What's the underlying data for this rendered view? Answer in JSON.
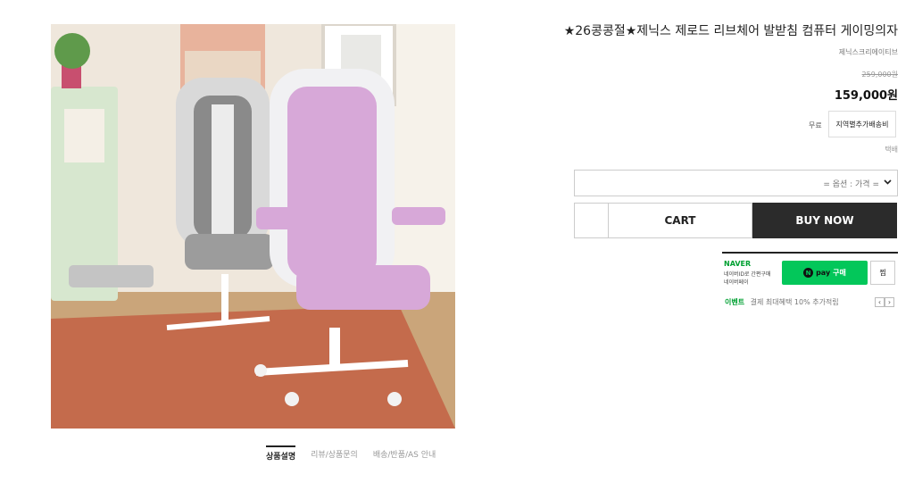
{
  "product": {
    "title": "★26콩콩절★제닉스 제로드 리브체어 발받침 컴퓨터 게이밍의자",
    "brand": "제닉스크리에이티브",
    "original_price": "259,000원",
    "sale_price": "159,000원",
    "image_icon": "gaming-chairs-photo"
  },
  "shipping": {
    "fee_label": "무료",
    "extra_button": "지역별추가배송비",
    "method": "택배"
  },
  "option": {
    "placeholder": "= 옵션 : 가격 =",
    "icon": "chevron-down-icon"
  },
  "actions": {
    "cart": "CART",
    "buy": "BUY NOW"
  },
  "naver_pay": {
    "brand": "NAVER",
    "desc_line1": "네이버ID로 간편구매",
    "desc_line2": "네이버페이",
    "pay_n": "N",
    "pay_text": "pay",
    "pay_buy": "구매",
    "wish": "찜",
    "event_label": "이벤트",
    "event_text": "결제 최대혜택 10% 추가적립",
    "prev": "‹",
    "next": "›",
    "accent_color": "#03c75a"
  },
  "tabs": [
    {
      "label": "상품설명",
      "active": true
    },
    {
      "label": "리뷰/상품문의",
      "active": false
    },
    {
      "label": "배송/반품/AS 안내",
      "active": false
    }
  ]
}
